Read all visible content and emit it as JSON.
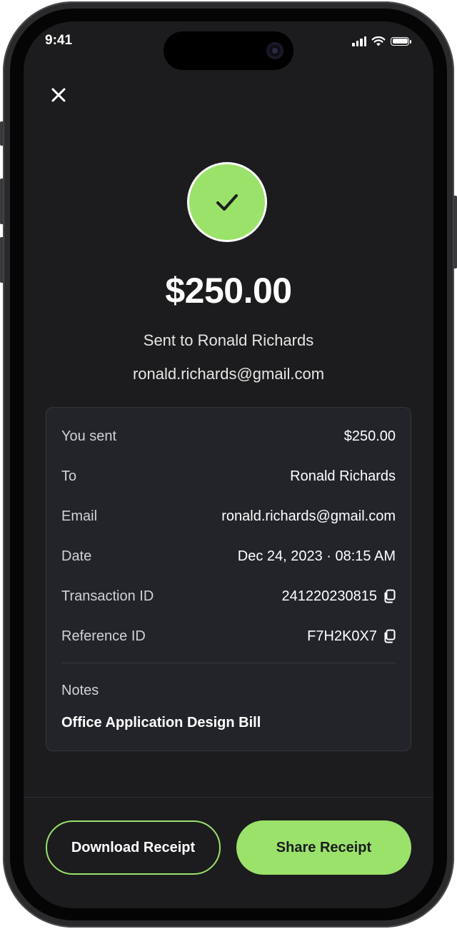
{
  "status_bar": {
    "time": "9:41"
  },
  "payment": {
    "amount": "$250.00",
    "sent_to": "Sent to Ronald Richards",
    "email": "ronald.richards@gmail.com"
  },
  "details": {
    "rows": [
      {
        "label": "You sent",
        "value": "$250.00"
      },
      {
        "label": "To",
        "value": "Ronald Richards"
      },
      {
        "label": "Email",
        "value": "ronald.richards@gmail.com"
      },
      {
        "label": "Date",
        "value": "Dec 24, 2023 · 08:15 AM"
      },
      {
        "label": "Transaction ID",
        "value": "241220230815"
      },
      {
        "label": "Reference ID",
        "value": "F7H2K0X7"
      }
    ],
    "notes_label": "Notes",
    "notes_value": "Office Application Design Bill"
  },
  "actions": {
    "download_label": "Download Receipt",
    "share_label": "Share Receipt"
  },
  "colors": {
    "accent": "#9be26a",
    "background": "#1c1c1e",
    "card": "#22242a"
  },
  "icons": [
    "close-icon",
    "checkmark-icon",
    "copy-icon",
    "signal-icon",
    "wifi-icon",
    "battery-icon"
  ]
}
